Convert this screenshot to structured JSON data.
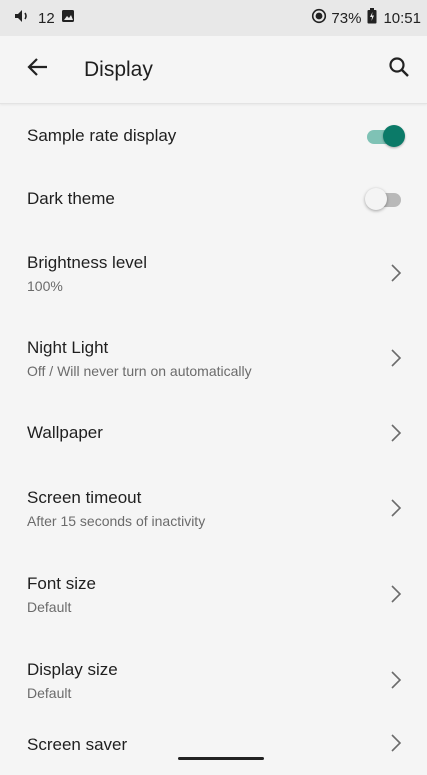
{
  "status_bar": {
    "volume_icon": "volume-icon",
    "notification_count": "12",
    "image_icon": "image-notification-icon",
    "record_icon": "record-icon",
    "battery_percent": "73%",
    "battery_icon": "battery-icon",
    "time": "10:51"
  },
  "app_bar": {
    "back_icon": "back-arrow-icon",
    "title": "Display",
    "search_icon": "search-icon"
  },
  "settings": [
    {
      "title": "Sample rate display",
      "control": "toggle",
      "enabled": true
    },
    {
      "title": "Dark theme",
      "control": "toggle",
      "enabled": false
    },
    {
      "title": "Brightness level",
      "subtitle": "100%",
      "control": "chevron"
    },
    {
      "title": "Night Light",
      "subtitle": "Off / Will never turn on automatically",
      "control": "chevron"
    },
    {
      "title": "Wallpaper",
      "control": "chevron"
    },
    {
      "title": "Screen timeout",
      "subtitle": "After 15 seconds of inactivity",
      "control": "chevron"
    },
    {
      "title": "Font size",
      "subtitle": "Default",
      "control": "chevron"
    },
    {
      "title": "Display size",
      "subtitle": "Default",
      "control": "chevron"
    },
    {
      "title": "Screen saver",
      "control": "chevron"
    }
  ],
  "colors": {
    "accent": "#0b7a68",
    "accent_track": "#7fc2b5",
    "background": "#f5f5f5",
    "status_bar": "#e8e8e8"
  }
}
